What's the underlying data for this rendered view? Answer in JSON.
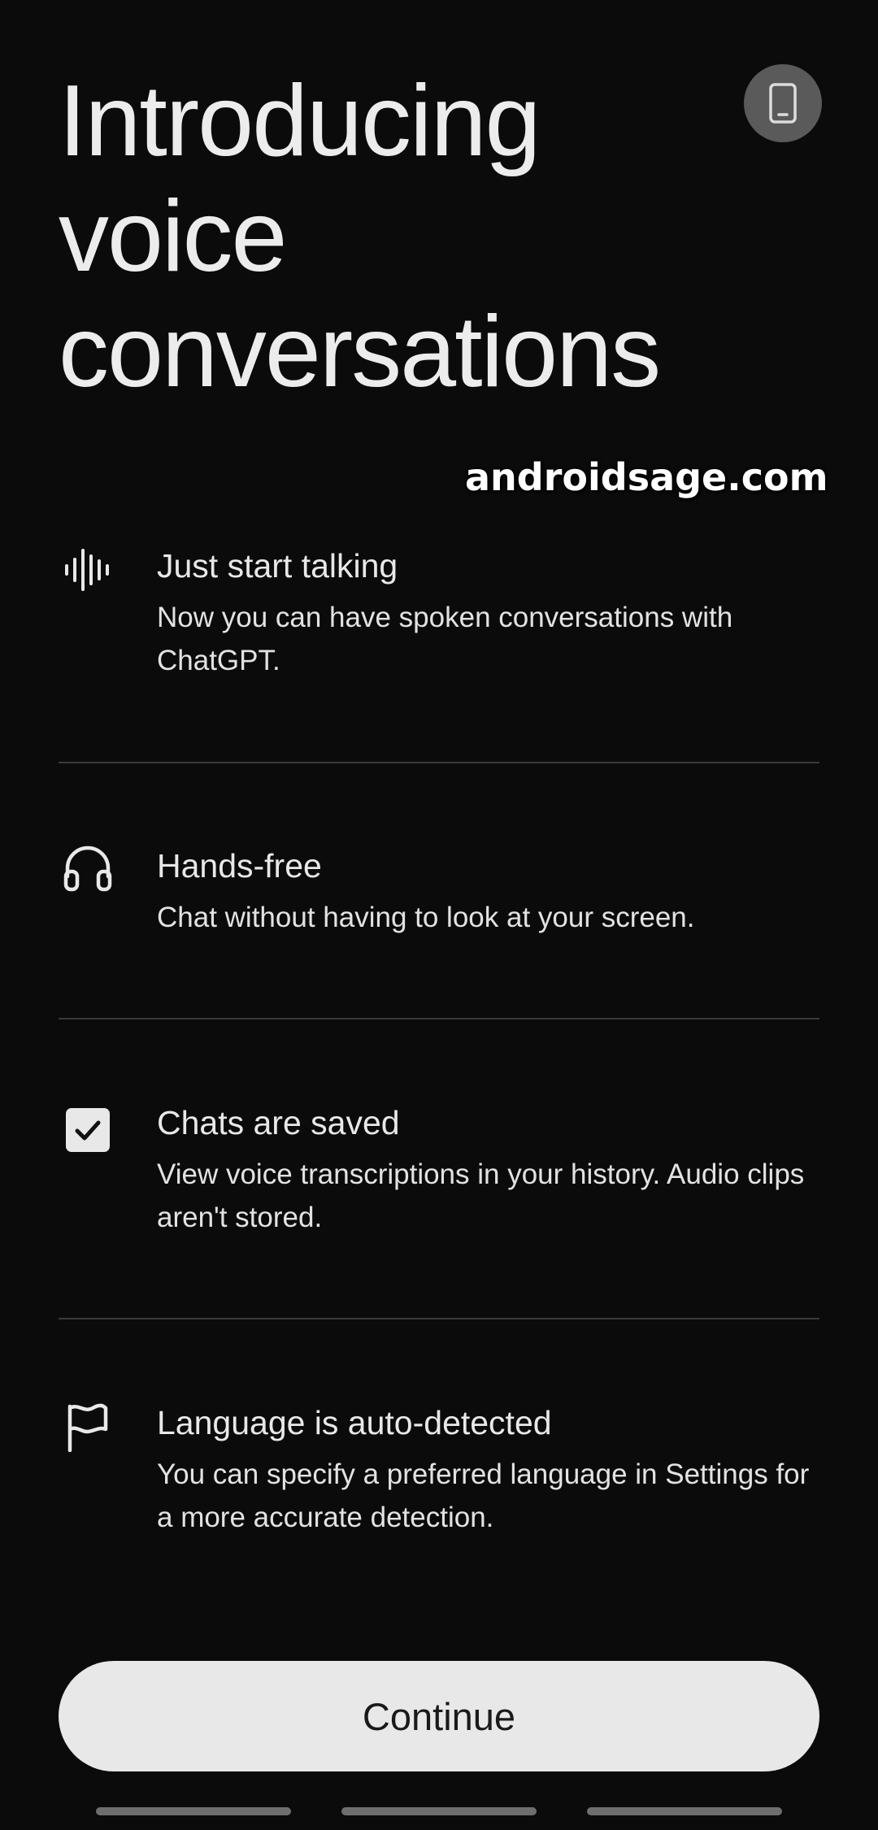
{
  "title": "Introducing voice conversations",
  "watermark": "androidsage.com",
  "device_button": {
    "icon": "phone-icon"
  },
  "features": [
    {
      "icon": "waveform-icon",
      "title": "Just start talking",
      "description": "Now you can have spoken conversations with ChatGPT."
    },
    {
      "icon": "headphones-icon",
      "title": "Hands-free",
      "description": "Chat without having to look at your screen."
    },
    {
      "icon": "checkbox-icon",
      "title": "Chats are saved",
      "description": "View voice transcriptions in your history. Audio clips aren't stored."
    },
    {
      "icon": "flag-icon",
      "title": "Language is auto-detected",
      "description": "You can specify a preferred language in Settings for a more accurate detection."
    }
  ],
  "continue_label": "Continue",
  "colors": {
    "background": "#0b0b0b",
    "text": "#e8e8e8",
    "button_bg": "#e8e8e8",
    "button_text": "#1a1a1a",
    "divider": "#3a3a3a",
    "device_button_bg": "#5a5a5a"
  }
}
